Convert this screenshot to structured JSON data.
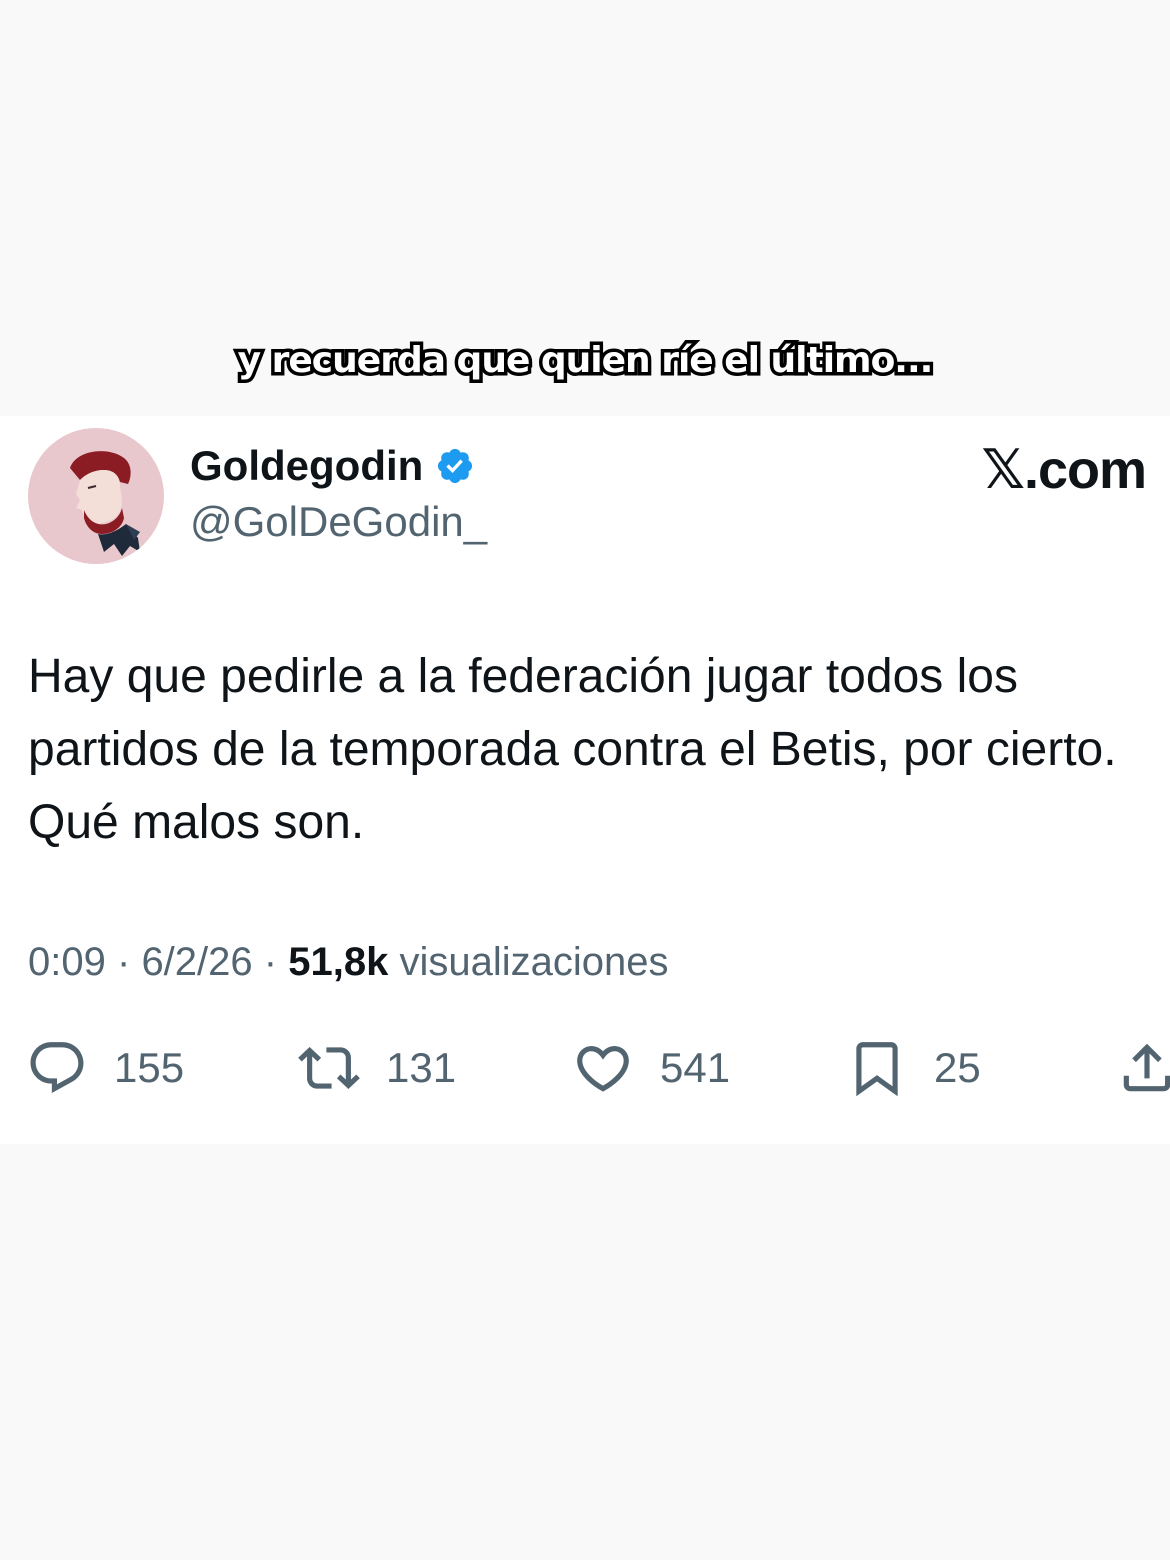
{
  "caption": "y recuerda que quien ríe el último...",
  "author": {
    "display_name": "Goldegodin",
    "handle": "@GolDeGodin_",
    "verified_icon": "verified-badge-icon"
  },
  "brand": "𝕏.com",
  "tweet": {
    "text": "Hay que pedirle a la federación jugar todos los partidos de la temporada contra el Betis, por cierto. Qué malos son."
  },
  "meta": {
    "time": "0:09",
    "separator": "·",
    "date": "6/2/26",
    "views_count": "51,8k",
    "views_label": "visualizaciones"
  },
  "actions": {
    "replies": "155",
    "reposts": "131",
    "likes": "541",
    "bookmarks": "25"
  },
  "colors": {
    "page_background": "#f9f9f9",
    "card_background": "#ffffff",
    "text_primary": "#0f1419",
    "text_secondary": "#536471",
    "verified_blue": "#1d9bf0",
    "avatar_background": "#e8c8cd"
  }
}
